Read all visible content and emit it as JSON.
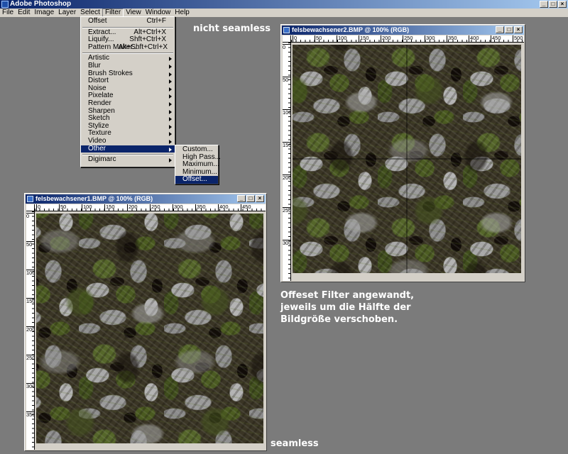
{
  "app": {
    "title": "Adobe Photoshop"
  },
  "menubar": [
    "File",
    "Edit",
    "Image",
    "Layer",
    "Select",
    "Filter",
    "View",
    "Window",
    "Help"
  ],
  "filter_menu": {
    "top": [
      {
        "label": "Offset",
        "shortcut": "Ctrl+F"
      }
    ],
    "mid": [
      {
        "label": "Extract...",
        "shortcut": "Alt+Ctrl+X"
      },
      {
        "label": "Liquify...",
        "shortcut": "Shft+Ctrl+X"
      },
      {
        "label": "Pattern Maker...",
        "shortcut": "Alt+Shft+Ctrl+X"
      }
    ],
    "submenus": [
      "Artistic",
      "Blur",
      "Brush Strokes",
      "Distort",
      "Noise",
      "Pixelate",
      "Render",
      "Sharpen",
      "Sketch",
      "Stylize",
      "Texture",
      "Video",
      "Other"
    ],
    "bottom": [
      "Digimarc"
    ],
    "highlighted": "Other"
  },
  "other_submenu": {
    "items": [
      "Custom...",
      "High Pass...",
      "Maximum...",
      "Minimum...",
      "Offset..."
    ],
    "highlighted": "Offset..."
  },
  "doc_right": {
    "title": "felsbewachsener2.BMP @ 100% (RGB)",
    "ruler_h": [
      "0",
      "50",
      "100",
      "150",
      "200",
      "250",
      "300",
      "350",
      "400",
      "450",
      "500"
    ],
    "ruler_v": [
      "0",
      "50",
      "100",
      "150",
      "200",
      "250",
      "300"
    ]
  },
  "doc_left": {
    "title": "felsbewachsener1.BMP @ 100% (RGB)",
    "ruler_h": [
      "0",
      "50",
      "100",
      "150",
      "200",
      "250",
      "300",
      "350",
      "400",
      "450"
    ],
    "ruler_v": [
      "0",
      "50",
      "100",
      "150",
      "200",
      "250",
      "300",
      "350"
    ]
  },
  "annotations": {
    "not_seamless": "nicht seamless",
    "seamless": "seamless",
    "explanation": [
      "Offeset Filter angewandt,",
      "jeweils um die Hälfte der",
      "Bildgröße verschoben."
    ]
  },
  "window_buttons": {
    "minimize": "_",
    "maximize": "□",
    "close": "×"
  },
  "colors": {
    "titlebar": "#0a246a",
    "desktop": "#7b7b7b",
    "highlight": "#0a246a"
  }
}
